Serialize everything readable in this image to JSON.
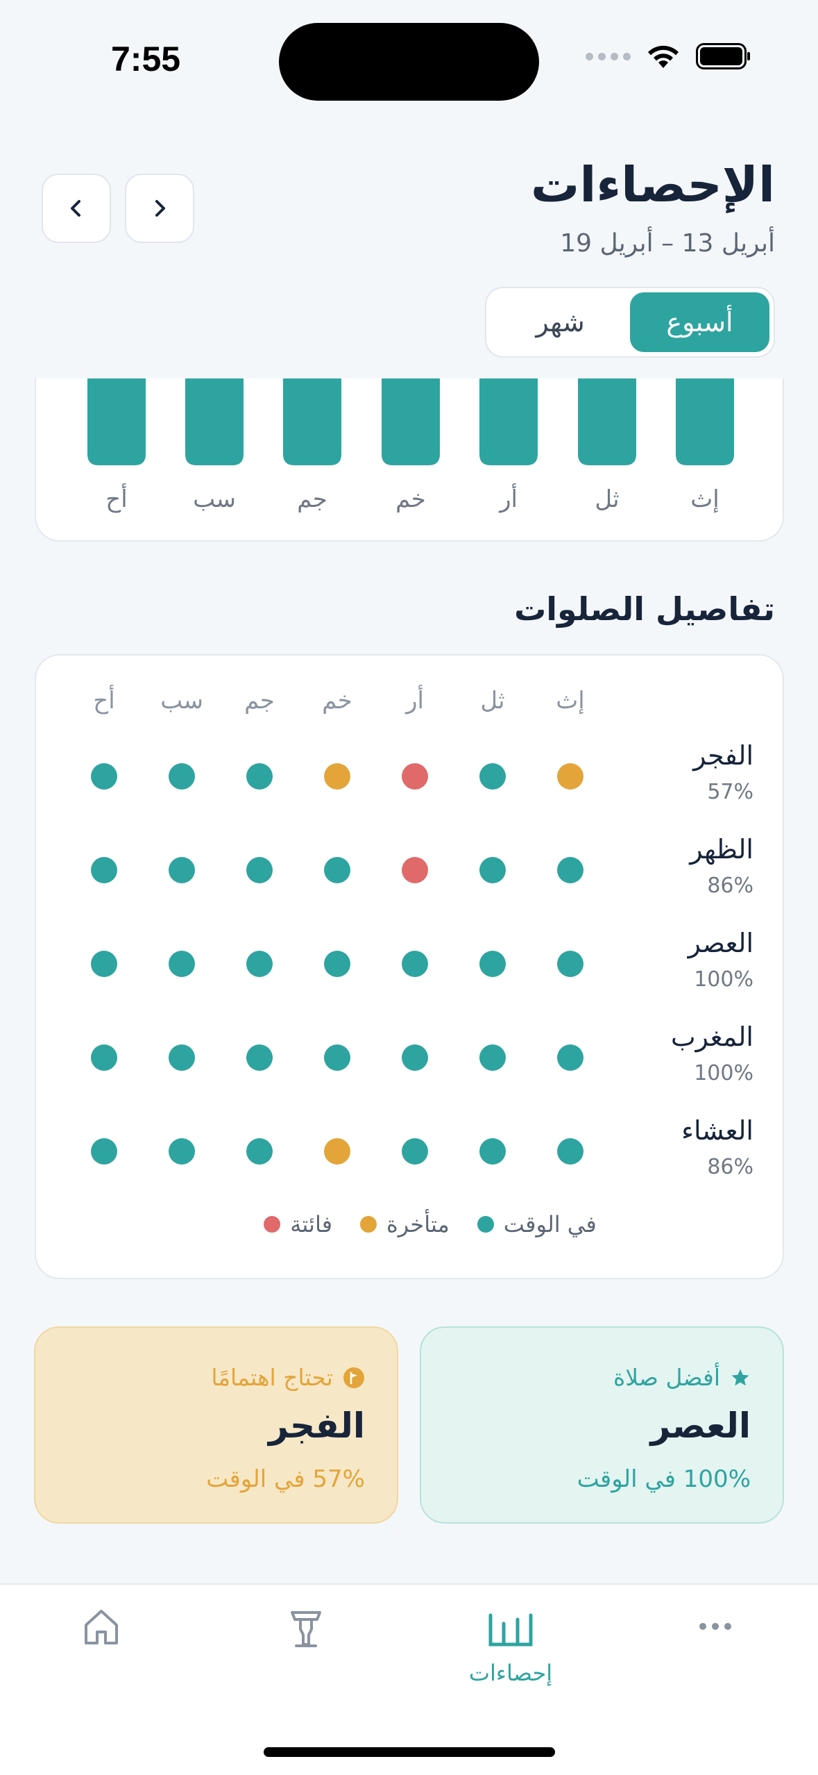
{
  "status_bar": {
    "time": "7:55"
  },
  "header": {
    "title": "الإحصاءات",
    "date_range": "أبريل 13 – أبريل 19",
    "prev_icon": "chevron-left-icon",
    "next_icon": "chevron-right-icon"
  },
  "segment": {
    "week_label": "أسبوع",
    "month_label": "شهر",
    "selected": "week"
  },
  "colors": {
    "accent": "#2ea4a0",
    "on_time": "#2ea4a0",
    "late": "#e3a53a",
    "missed": "#e06a6a"
  },
  "chart_data": {
    "type": "bar",
    "categories": [
      "إث",
      "ثل",
      "أر",
      "خم",
      "جم",
      "سب",
      "أح"
    ],
    "values": [
      5,
      5,
      5,
      5,
      5,
      5,
      5
    ],
    "title": "",
    "xlabel": "",
    "ylabel": "",
    "note": "bars scrolled partially out of view"
  },
  "details": {
    "section_title": "تفاصيل الصلوات",
    "days": [
      "إث",
      "ثل",
      "أر",
      "خم",
      "جم",
      "سب",
      "أح"
    ],
    "prayers": [
      {
        "name": "الفجر",
        "pct": "57%",
        "status": [
          "late",
          "on_time",
          "missed",
          "late",
          "on_time",
          "on_time",
          "on_time"
        ]
      },
      {
        "name": "الظهر",
        "pct": "86%",
        "status": [
          "on_time",
          "on_time",
          "missed",
          "on_time",
          "on_time",
          "on_time",
          "on_time"
        ]
      },
      {
        "name": "العصر",
        "pct": "100%",
        "status": [
          "on_time",
          "on_time",
          "on_time",
          "on_time",
          "on_time",
          "on_time",
          "on_time"
        ]
      },
      {
        "name": "المغرب",
        "pct": "100%",
        "status": [
          "on_time",
          "on_time",
          "on_time",
          "on_time",
          "on_time",
          "on_time",
          "on_time"
        ]
      },
      {
        "name": "العشاء",
        "pct": "86%",
        "status": [
          "on_time",
          "on_time",
          "on_time",
          "late",
          "on_time",
          "on_time",
          "on_time"
        ]
      }
    ],
    "legend": {
      "on_time": "في الوقت",
      "late": "متأخرة",
      "missed": "فائتة"
    }
  },
  "best_card": {
    "label": "أفضل صلاة",
    "prayer": "العصر",
    "sub": "100% في الوقت",
    "icon": "star-icon"
  },
  "attention_card": {
    "label": "تحتاج اهتمامًا",
    "prayer": "الفجر",
    "sub": "57% في الوقت",
    "icon": "flag-icon"
  },
  "tab_bar": {
    "items": [
      {
        "icon": "home-icon",
        "label": ""
      },
      {
        "icon": "mosque-lamp-icon",
        "label": ""
      },
      {
        "icon": "stats-icon",
        "label": "إحصاءات",
        "active": true
      },
      {
        "icon": "more-icon",
        "label": ""
      }
    ]
  }
}
